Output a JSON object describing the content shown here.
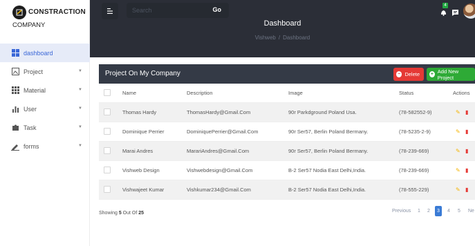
{
  "brand": {
    "name": "CONSTRACTION",
    "sub": "COMPANY"
  },
  "sidebar": {
    "items": [
      {
        "label": "dashboard",
        "icon": "grid-icon",
        "active": true
      },
      {
        "label": "Project",
        "icon": "image-icon"
      },
      {
        "label": "Material",
        "icon": "dots-grid-icon"
      },
      {
        "label": "User",
        "icon": "bar-chart-icon"
      },
      {
        "label": "Task",
        "icon": "puzzle-icon"
      },
      {
        "label": "forms",
        "icon": "pencil-icon"
      }
    ]
  },
  "header": {
    "search_placeholder": "Search",
    "go_label": "Go",
    "title": "Dashboard",
    "breadcrumb": [
      "Vishweb",
      "Dashboard"
    ],
    "breadcrumb_sep": "/",
    "notification_count": "4"
  },
  "card": {
    "title": "Project On My Company",
    "delete_label": "Delete",
    "add_label": "Add New Project"
  },
  "table": {
    "columns": [
      "Name",
      "Description",
      "Image",
      "Status",
      "Actions"
    ],
    "rows": [
      {
        "name": "Thomas Hardy",
        "description": "ThomasHardy@Gmail.Com",
        "image": "90r Parkdground Poland Usa.",
        "status": "(78-582552-9)"
      },
      {
        "name": "Dominique Perrier",
        "description": "DominiquePerrier@Gmail.Com",
        "image": "90r Ser57, Berlin Poland Bermany.",
        "status": "(78-5235-2-9)"
      },
      {
        "name": "Marai Andres",
        "description": "MarariAndres@Gmail.Com",
        "image": "90r Ser57, Berlin Poland Bermany.",
        "status": "(78-239-669)"
      },
      {
        "name": "Vishweb Design",
        "description": "Vishwebdesign@Gmail.Com",
        "image": "B-2 Ser57 Nodia East Delhi,India.",
        "status": "(78-239-669)"
      },
      {
        "name": "Vishwajeet Kumar",
        "description": "Vishkumar234@Gmail.Com",
        "image": "B-2 Ser57 Nodia East Delhi,India.",
        "status": "(78-555-229)"
      }
    ]
  },
  "footer": {
    "showing_prefix": "Showing",
    "shown": "5",
    "out_of": "Out Of",
    "total": "25",
    "previous": "Previous",
    "pages": [
      "1",
      "2",
      "3",
      "4",
      "5"
    ],
    "current_page": "3",
    "next": "Ne"
  },
  "colors": {
    "header": "#2b2e37",
    "accent": "#3a67d7",
    "delete": "#e53935",
    "add": "#2eaa36"
  }
}
